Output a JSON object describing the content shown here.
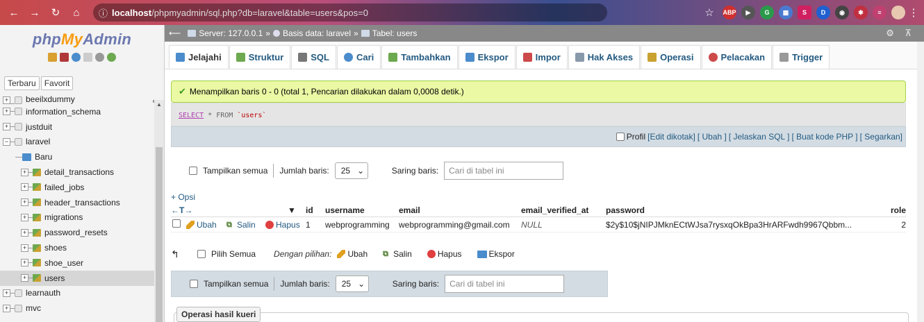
{
  "browser": {
    "url_host": "localhost",
    "url_path": "/phpmyadmin/sql.php?db=laravel&table=users&pos=0",
    "extensions": [
      "ABP",
      "G",
      "S",
      "D"
    ]
  },
  "sidebar": {
    "logo_php": "php",
    "logo_my": "My",
    "logo_admin": "Admin",
    "tab_recent": "Terbaru",
    "tab_favorite": "Favorit",
    "tree": [
      {
        "label": "beeilxdummy",
        "type": "db"
      },
      {
        "label": "information_schema",
        "type": "db"
      },
      {
        "label": "justduit",
        "type": "db"
      },
      {
        "label": "laravel",
        "type": "db-open"
      },
      {
        "label": "Baru",
        "type": "new"
      },
      {
        "label": "detail_transactions",
        "type": "table"
      },
      {
        "label": "failed_jobs",
        "type": "table"
      },
      {
        "label": "header_transactions",
        "type": "table"
      },
      {
        "label": "migrations",
        "type": "table"
      },
      {
        "label": "password_resets",
        "type": "table"
      },
      {
        "label": "shoes",
        "type": "table"
      },
      {
        "label": "shoe_user",
        "type": "table"
      },
      {
        "label": "users",
        "type": "table-selected"
      },
      {
        "label": "learnauth",
        "type": "db"
      },
      {
        "label": "mvc",
        "type": "db"
      }
    ]
  },
  "breadcrumb": {
    "server": "Server: 127.0.0.1",
    "sep1": "»",
    "database": "Basis data: laravel",
    "sep2": "»",
    "table": "Tabel: users"
  },
  "tabs": [
    {
      "label": "Jelajahi",
      "color": "#4a8ccc"
    },
    {
      "label": "Struktur",
      "color": "#6da94f"
    },
    {
      "label": "SQL",
      "color": "#777777"
    },
    {
      "label": "Cari",
      "color": "#4a8ccc"
    },
    {
      "label": "Tambahkan",
      "color": "#6da94f"
    },
    {
      "label": "Ekspor",
      "color": "#4a8ccc"
    },
    {
      "label": "Impor",
      "color": "#cc4a4a"
    },
    {
      "label": "Hak Akses",
      "color": "#8899aa"
    },
    {
      "label": "Operasi",
      "color": "#c9a232"
    },
    {
      "label": "Pelacakan",
      "color": "#cc4a4a"
    },
    {
      "label": "Trigger",
      "color": "#999999"
    }
  ],
  "success_message": "Menampilkan baris 0 - 0 (total 1, Pencarian dilakukan dalam 0,0008 detik.)",
  "sql": {
    "select": "SELECT",
    "star": "* FROM",
    "table": "`users`"
  },
  "profile_bar": {
    "profile": "Profil",
    "edit_inline": "[Edit dikotak]",
    "edit": "[ Ubah ]",
    "explain": "[ Jelaskan SQL ]",
    "php_code": "[ Buat kode PHP ]",
    "refresh": "[ Segarkan]"
  },
  "navigation": {
    "show_all": "Tampilkan semua",
    "rows_label": "Jumlah baris:",
    "rows_value": "25",
    "filter_label": "Saring baris:",
    "filter_placeholder": "Cari di tabel ini"
  },
  "opsi": "+ Opsi",
  "table": {
    "sort_arrows": "←T→",
    "columns": [
      "id",
      "username",
      "email",
      "email_verified_at",
      "password",
      "role"
    ],
    "rows": [
      {
        "edit": "Ubah",
        "copy": "Salin",
        "delete": "Hapus",
        "id": "1",
        "username": "webprogramming",
        "email": "webprogramming@gmail.com",
        "email_verified_at": "NULL",
        "password": "$2y$10$jNIPJMknECtWJsa7rysxqOkBpa3HrARFwdh9967Qbbm...",
        "role": "2"
      }
    ]
  },
  "bulk": {
    "select_all": "Pilih Semua",
    "with_selected": "Dengan pilihan:",
    "edit": "Ubah",
    "copy": "Salin",
    "delete": "Hapus",
    "export": "Ekspor"
  },
  "query_ops": "Operasi hasil kueri"
}
